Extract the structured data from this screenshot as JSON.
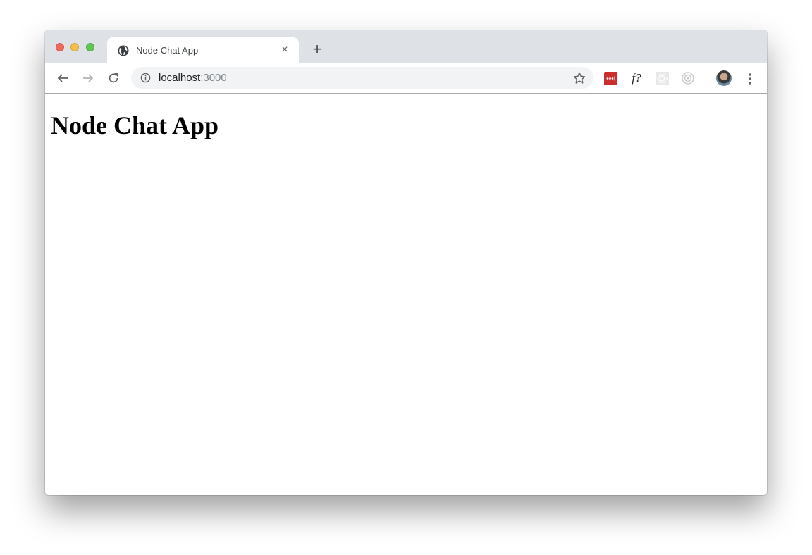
{
  "browser": {
    "tab": {
      "title": "Node Chat App",
      "favicon": "globe-icon",
      "close_icon": "×"
    },
    "new_tab_icon": "+",
    "nav": {
      "back": "arrow-left-icon",
      "forward": "arrow-right-icon",
      "reload": "reload-icon"
    },
    "address": {
      "host": "localhost",
      "port": ":3000",
      "info_icon": "info-icon",
      "bookmark_icon": "star-icon"
    },
    "extensions": [
      {
        "name": "lastpass-extension",
        "icon": "lastpass-icon",
        "color": "#cc2d2d"
      },
      {
        "name": "fontface-ninja-extension",
        "label": "f?"
      },
      {
        "name": "react-devtools-extension",
        "icon": "react-icon"
      },
      {
        "name": "extension-target",
        "icon": "target-icon"
      }
    ],
    "profile": {
      "icon": "avatar"
    },
    "menu_icon": "kebab-menu-icon"
  },
  "page": {
    "heading": "Node Chat App"
  }
}
